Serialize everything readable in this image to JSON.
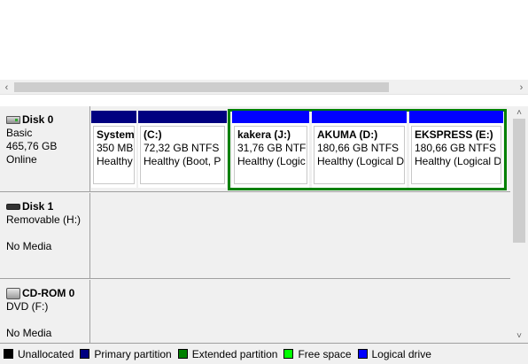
{
  "disks": [
    {
      "name": "Disk 0",
      "type": "Basic",
      "size": "465,76 GB",
      "status": "Online",
      "icon": "hard-disk-icon"
    },
    {
      "name": "Disk 1",
      "type": "Removable (H:)",
      "media": "No Media",
      "icon": "removable-disk-icon"
    },
    {
      "name": "CD-ROM 0",
      "type": "DVD (F:)",
      "media": "No Media",
      "icon": "cdrom-icon"
    }
  ],
  "partitions": [
    {
      "name": "System",
      "size": "350 MB",
      "status": "Healthy"
    },
    {
      "name": "(C:)",
      "size": "72,32 GB NTFS",
      "status": "Healthy (Boot, P"
    },
    {
      "name": "kakera  (J:)",
      "size": "31,76 GB NTFS",
      "status": "Healthy (Logic"
    },
    {
      "name": "AKUMA  (D:)",
      "size": "180,66 GB NTFS",
      "status": "Healthy (Logical D"
    },
    {
      "name": "EKSPRESS  (E:)",
      "size": "180,66 GB NTFS",
      "status": "Healthy (Logical D"
    }
  ],
  "legend": [
    {
      "label": "Unallocated",
      "color": "#000000"
    },
    {
      "label": "Primary partition",
      "color": "#000080"
    },
    {
      "label": "Extended partition",
      "color": "#008000"
    },
    {
      "label": "Free space",
      "color": "#00ff00"
    },
    {
      "label": "Logical drive",
      "color": "#0000ff"
    }
  ],
  "colors": {
    "primary": "#000080",
    "logical": "#0000ff",
    "extended": "#008000"
  }
}
